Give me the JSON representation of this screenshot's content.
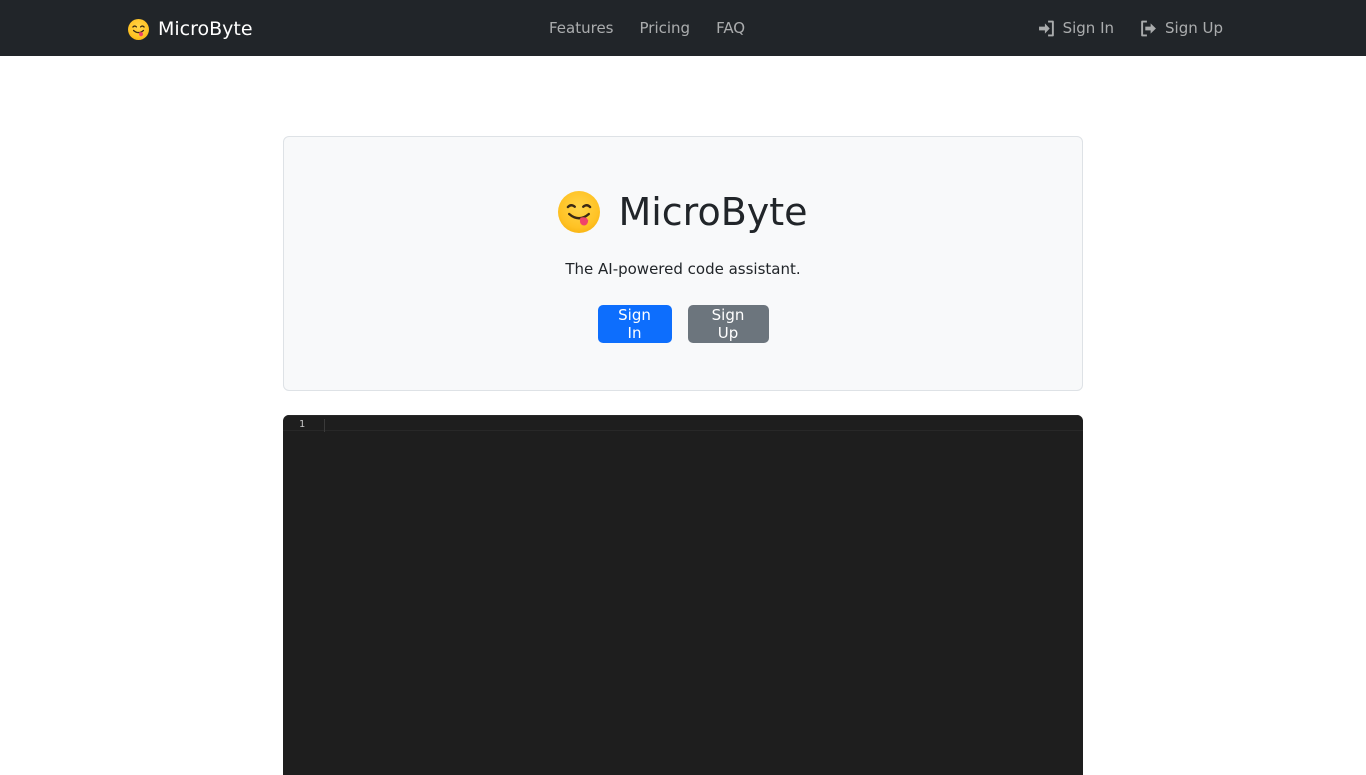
{
  "navbar": {
    "brand": "MicroByte",
    "links": [
      "Features",
      "Pricing",
      "FAQ"
    ],
    "sign_in": "Sign In",
    "sign_up": "Sign Up"
  },
  "hero": {
    "title": "MicroByte",
    "subtitle": "The AI-powered code assistant.",
    "sign_in_button": "Sign In",
    "sign_up_button": "Sign Up"
  },
  "editor": {
    "line_numbers": [
      "1"
    ]
  },
  "icons": {
    "logo": "face-savoring-food-emoji-icon",
    "sign_in": "sign-in-icon",
    "sign_up": "sign-up-icon"
  },
  "colors": {
    "navbar_bg": "#212529",
    "primary": "#0d6efd",
    "secondary": "#6c757d",
    "hero_bg": "#f8f9fa",
    "editor_bg": "#1e1e1e"
  }
}
